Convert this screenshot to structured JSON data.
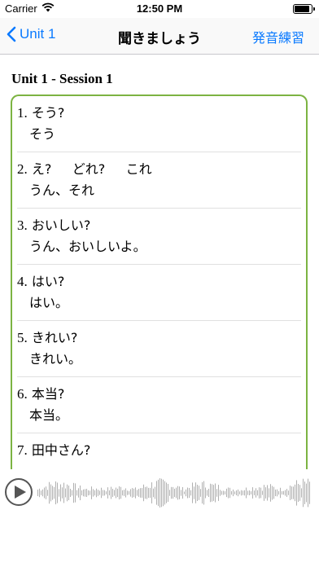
{
  "status": {
    "carrier": "Carrier",
    "time": "12:50 PM",
    "battery_level": 1.0
  },
  "nav": {
    "back_label": "Unit 1",
    "title": "聞きましょう",
    "right_label": "発音練習"
  },
  "section": {
    "title": "Unit 1 - Session 1"
  },
  "items": [
    {
      "num": "1.",
      "q": " そう?",
      "a": "そう"
    },
    {
      "num": "2.",
      "q": " え?     どれ?     これ",
      "a": "うん、それ"
    },
    {
      "num": "3.",
      "q": " おいしい?",
      "a": "うん、おいしいよ。"
    },
    {
      "num": "4.",
      "q": " はい?",
      "a": "はい。"
    },
    {
      "num": "5.",
      "q": " きれい?",
      "a": "きれい。"
    },
    {
      "num": "6.",
      "q": " 本当?",
      "a": "本当。"
    },
    {
      "num": "7.",
      "q": " 田中さん?",
      "a": ""
    }
  ],
  "colors": {
    "accent": "#0a7aff",
    "list_border": "#7cb342",
    "waveform": "#b0b0b0"
  },
  "icons": {
    "back": "chevron-left-icon",
    "play": "play-icon",
    "wifi": "wifi-icon",
    "battery": "battery-icon"
  }
}
